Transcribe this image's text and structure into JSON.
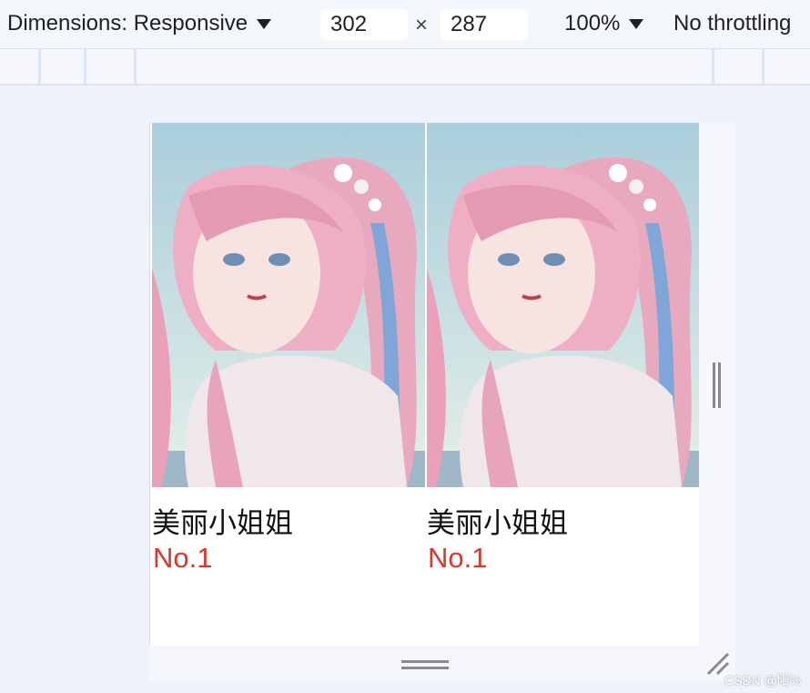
{
  "toolbar": {
    "dimensions_label": "Dimensions: Responsive",
    "width_value": "302",
    "times_symbol": "×",
    "height_value": "287",
    "zoom_label": "100%",
    "throttling_label": "No throttling"
  },
  "cards": [
    {
      "title": "美丽小姐姐",
      "rank": "No.1"
    },
    {
      "title": "美丽小姐姐",
      "rank": "No.1"
    }
  ],
  "watermark": "CSDN @阳%",
  "colors": {
    "rank": "#e0352b",
    "toolbar_bg": "#f3f6fb",
    "page_bg": "#eef2fa"
  },
  "icons": {
    "dimensions_dropdown": "caret-down-icon",
    "zoom_dropdown": "caret-down-icon",
    "side_resize": "resize-handle-vertical-icon",
    "bottom_resize": "resize-handle-horizontal-icon",
    "corner_resize": "corner-resize-icon"
  }
}
